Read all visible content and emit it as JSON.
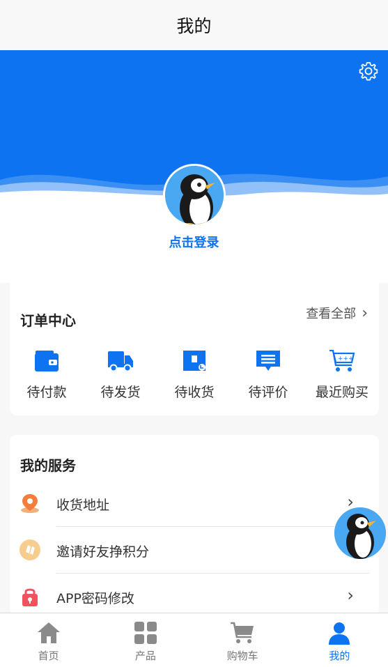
{
  "header": {
    "title": "我的"
  },
  "colors": {
    "accent": "#0d73f0",
    "hero": "#0d73f0",
    "background": "#f7f7f7"
  },
  "settings": {
    "icon": "gear-icon"
  },
  "profile": {
    "login_label": "点击登录",
    "avatar_icon": "penguin-avatar"
  },
  "orders": {
    "title": "订单中心",
    "view_all": "查看全部",
    "items": [
      {
        "label": "待付款",
        "icon": "wallet-icon"
      },
      {
        "label": "待发货",
        "icon": "truck-icon"
      },
      {
        "label": "待收货",
        "icon": "package-icon"
      },
      {
        "label": "待评价",
        "icon": "comment-icon"
      },
      {
        "label": "最近购买",
        "icon": "cart-icon"
      }
    ]
  },
  "services": {
    "title": "我的服务",
    "items": [
      {
        "label": "收货地址",
        "icon": "location-pin-icon",
        "color": "#f57c3a"
      },
      {
        "label": "邀请好友挣积分",
        "icon": "invite-icon",
        "color": "#f5c07a"
      },
      {
        "label": "APP密码修改",
        "icon": "lock-icon",
        "color": "#f0525f"
      }
    ]
  },
  "tabbar": {
    "items": [
      {
        "label": "首页",
        "icon": "home-icon",
        "active": false
      },
      {
        "label": "产品",
        "icon": "grid-icon",
        "active": false
      },
      {
        "label": "购物车",
        "icon": "cart-icon",
        "active": false
      },
      {
        "label": "我的",
        "icon": "user-icon",
        "active": true
      }
    ]
  }
}
